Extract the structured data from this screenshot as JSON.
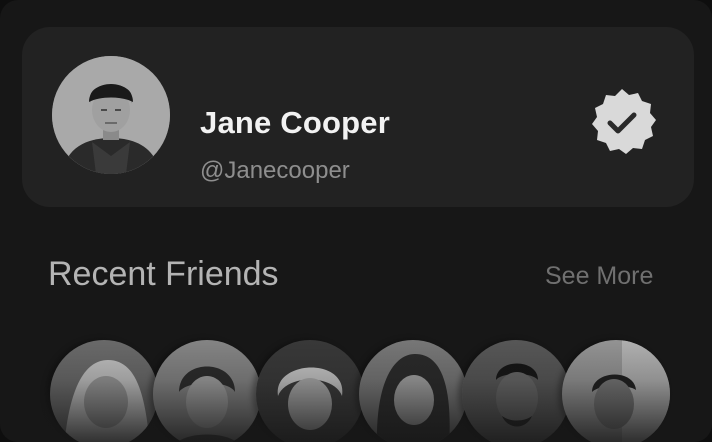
{
  "profile": {
    "name": "Jane Cooper",
    "handle": "@Janecooper",
    "verified": true,
    "avatar": "profile-photo"
  },
  "recent_friends": {
    "title": "Recent Friends",
    "see_more_label": "See More",
    "friends": [
      {
        "avatar": "friend-photo-1"
      },
      {
        "avatar": "friend-photo-2"
      },
      {
        "avatar": "friend-photo-3"
      },
      {
        "avatar": "friend-photo-4"
      },
      {
        "avatar": "friend-photo-5"
      },
      {
        "avatar": "friend-photo-6"
      }
    ]
  },
  "colors": {
    "background": "#171717",
    "card": "#222222",
    "name_text": "#f2f2f2",
    "handle_text": "#8e8e8e",
    "badge": "#d9d9d9",
    "badge_check": "#2a2a2a"
  },
  "icons": {
    "verified": "verified-badge-icon"
  }
}
